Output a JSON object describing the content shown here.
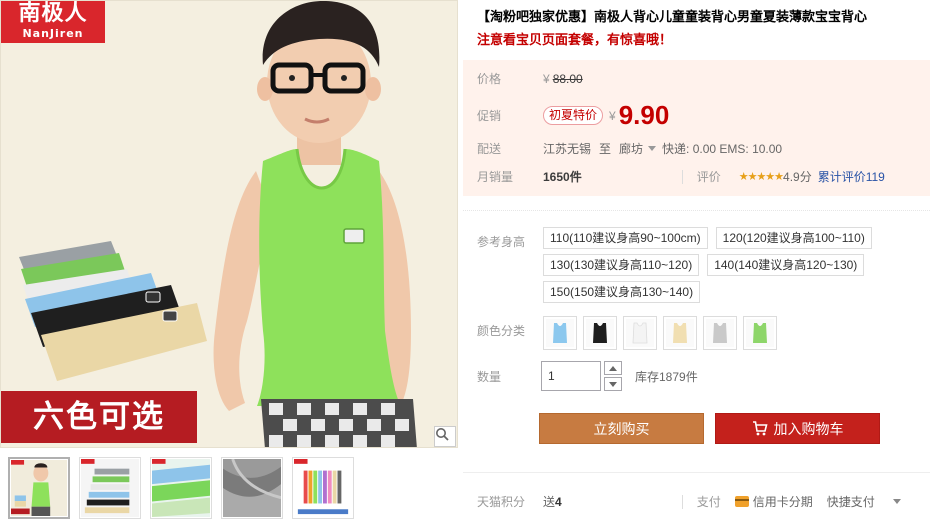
{
  "brand": {
    "logo_cn": "南极人",
    "logo_en": "NanJiren"
  },
  "gallery": {
    "banner_text": "六色可选",
    "thumbnails": [
      {
        "name": "green-vest-boy",
        "active": true
      },
      {
        "name": "folded-vests"
      },
      {
        "name": "fabric-closeup"
      },
      {
        "name": "gray-fabric"
      },
      {
        "name": "colorful-stack"
      }
    ]
  },
  "product": {
    "title": "【淘粉吧独家优惠】南极人背心儿童童装背心男童夏装薄款宝宝背心",
    "subtitle": "注意看宝贝页面套餐，有惊喜哦！"
  },
  "price": {
    "label": "价格",
    "currency": "¥",
    "original": "88.00",
    "promo_label": "促销",
    "promo_tag": "初夏特价",
    "sale": "9.90"
  },
  "delivery": {
    "label": "配送",
    "from": "江苏无锡",
    "to_word": "至",
    "to": "廊坊",
    "fees": "快递: 0.00 EMS: 10.00"
  },
  "stats": {
    "monthly_sales_label": "月销量",
    "monthly_sales": "1650件",
    "rating_label": "评价",
    "stars": "★★★★★",
    "score": "4.9分",
    "cumulative_reviews": "累计评价119"
  },
  "sizes": {
    "label": "参考身高",
    "options": [
      "110(110建议身高90~100cm)",
      "120(120建议身高100~110)",
      "130(130建议身高110~120)",
      "140(140建议身高120~130)",
      "150(150建议身高130~140)"
    ]
  },
  "colors": {
    "label": "颜色分类",
    "swatches": [
      {
        "name": "light-blue",
        "hex": "#8cc8ee"
      },
      {
        "name": "black",
        "hex": "#1d1d1d"
      },
      {
        "name": "white",
        "hex": "#f4f4f4"
      },
      {
        "name": "beige",
        "hex": "#f1dfb2"
      },
      {
        "name": "gray",
        "hex": "#c9c9c9"
      },
      {
        "name": "green",
        "hex": "#8ed66a"
      }
    ]
  },
  "quantity": {
    "label": "数量",
    "value": "1",
    "stock": "库存1879件"
  },
  "actions": {
    "buy_now": "立刻购买",
    "add_to_cart": "加入购物车"
  },
  "footer": {
    "points_label": "天猫积分",
    "points_prefix": "送",
    "points_value": "4",
    "pay_label": "支付",
    "installment": "信用卡分期",
    "quick_pay": "快捷支付"
  },
  "colors_theme": {
    "accent_red": "#c40000",
    "buy_orange": "#c77b41",
    "cart_red": "#c4211c",
    "panel_bg": "#fff2ec"
  }
}
